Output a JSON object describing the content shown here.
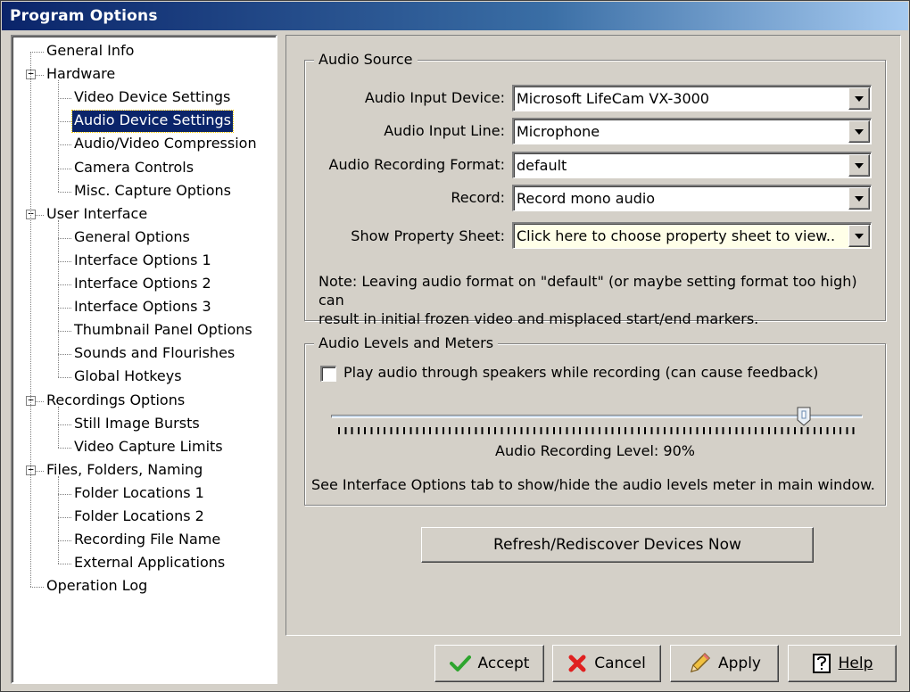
{
  "window": {
    "title": "Program Options"
  },
  "tree": {
    "items": [
      {
        "label": "General Info",
        "level": 0,
        "expander": false
      },
      {
        "label": "Hardware",
        "level": 0,
        "expander": true
      },
      {
        "label": "Video Device Settings",
        "level": 1
      },
      {
        "label": "Audio Device Settings",
        "level": 1,
        "selected": true
      },
      {
        "label": "Audio/Video Compression",
        "level": 1
      },
      {
        "label": "Camera Controls",
        "level": 1
      },
      {
        "label": "Misc. Capture Options",
        "level": 1
      },
      {
        "label": "User Interface",
        "level": 0,
        "expander": true
      },
      {
        "label": "General Options",
        "level": 1
      },
      {
        "label": "Interface Options 1",
        "level": 1
      },
      {
        "label": "Interface Options 2",
        "level": 1
      },
      {
        "label": "Interface Options 3",
        "level": 1
      },
      {
        "label": "Thumbnail Panel Options",
        "level": 1
      },
      {
        "label": "Sounds and Flourishes",
        "level": 1
      },
      {
        "label": "Global Hotkeys",
        "level": 1
      },
      {
        "label": "Recordings Options",
        "level": 0,
        "expander": true
      },
      {
        "label": "Still Image Bursts",
        "level": 1
      },
      {
        "label": "Video Capture Limits",
        "level": 1
      },
      {
        "label": "Files, Folders, Naming",
        "level": 0,
        "expander": true
      },
      {
        "label": "Folder Locations 1",
        "level": 1
      },
      {
        "label": "Folder Locations 2",
        "level": 1
      },
      {
        "label": "Recording File Name",
        "level": 1
      },
      {
        "label": "External Applications",
        "level": 1
      },
      {
        "label": "Operation Log",
        "level": 0,
        "expander": false
      }
    ]
  },
  "audio_source": {
    "title": "Audio Source",
    "input_device_label": "Audio Input Device:",
    "input_device_value": "Microsoft LifeCam VX-3000",
    "input_line_label": "Audio Input Line:",
    "input_line_value": "Microphone",
    "format_label": "Audio Recording Format:",
    "format_value": "default",
    "record_label": "Record:",
    "record_value": "Record mono audio",
    "property_sheet_label": "Show Property Sheet:",
    "property_sheet_value": "Click here to choose property sheet to view..",
    "note_line1": "Note: Leaving audio format on \"default\" (or maybe setting format too high) can",
    "note_line2": "result in initial frozen video and misplaced start/end markers."
  },
  "audio_levels": {
    "title": "Audio Levels and Meters",
    "play_checkbox_label": "Play audio through speakers while recording (can cause feedback)",
    "play_checked": false,
    "level_label": "Audio Recording Level: 90%",
    "level_fraction": 0.9,
    "hint": "See Interface Options tab to show/hide the audio levels meter in main window."
  },
  "refresh_button": "Refresh/Rediscover Devices Now",
  "buttons": {
    "accept": "Accept",
    "cancel": "Cancel",
    "apply": "Apply",
    "help": "Help"
  },
  "colors": {
    "selection": "#0a246a",
    "title_start": "#0a246a",
    "title_end": "#a6caf0",
    "accept_icon": "#2ea52e",
    "cancel_icon": "#e02020"
  }
}
